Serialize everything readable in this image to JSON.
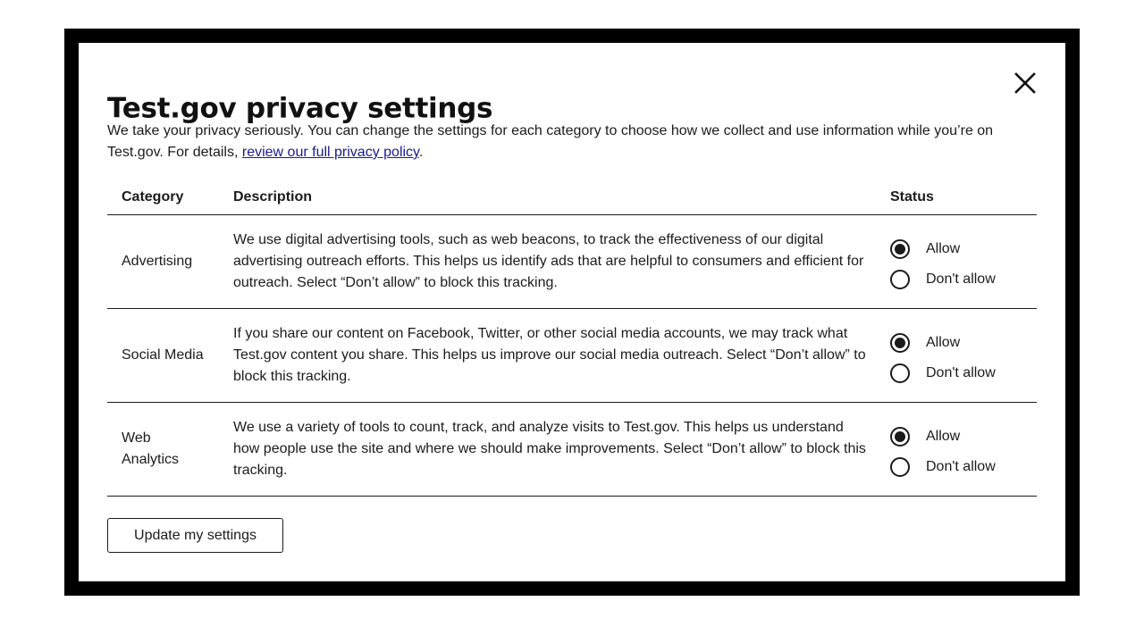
{
  "dialog": {
    "title": "Test.gov privacy settings",
    "close_icon": "close-icon",
    "intro": {
      "text_before": "We take your privacy seriously. You can change the settings for each category to choose how we collect and use information while you’re on Test.gov. For details, ",
      "link_text": "review our full privacy policy",
      "text_after": "."
    },
    "table": {
      "headers": {
        "category": "Category",
        "description": "Description",
        "status": "Status"
      },
      "rows": [
        {
          "category": "Advertising",
          "description": "We use digital advertising tools, such as web beacons, to track the effectiveness of our digital advertising outreach efforts. This helps us identify ads that are helpful to consumers and efficient for outreach. Select “Don’t allow” to block this tracking.",
          "allow_label": "Allow",
          "disallow_label": "Don't allow",
          "selected": "allow"
        },
        {
          "category": "Social Media",
          "description": "If you share our content on Facebook, Twitter, or other social media accounts, we may track what Test.gov content you share. This helps us improve our social media outreach. Select “Don’t allow” to block this tracking.",
          "allow_label": "Allow",
          "disallow_label": "Don't allow",
          "selected": "allow"
        },
        {
          "category": "Web Analytics",
          "description": "We use a variety of tools to count, track, and analyze visits to Test.gov. This helps us understand how people use the site and where we should make improvements. Select “Don’t allow” to block this tracking.",
          "allow_label": "Allow",
          "disallow_label": "Don't allow",
          "selected": "allow"
        }
      ]
    },
    "update_button": "Update my settings"
  },
  "colors": {
    "frame": "#000000",
    "text": "#1b1b1b",
    "link": "#1a1a8c",
    "background": "#ffffff"
  }
}
